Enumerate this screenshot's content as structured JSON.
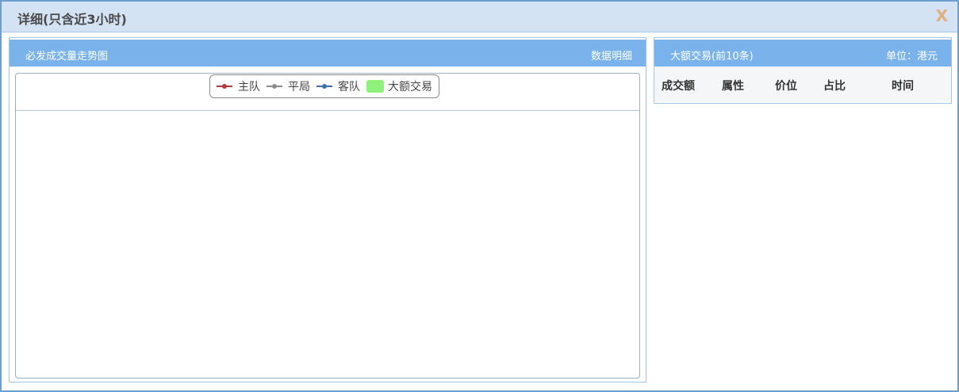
{
  "dialog": {
    "title": "详细(只含近3小时)",
    "close_label": "X"
  },
  "trend_panel": {
    "title": "必发成交量走势图",
    "detail_link": "数据明细",
    "legend": [
      {
        "label": "主队",
        "kind": "line",
        "color": "#b33a3a"
      },
      {
        "label": "平局",
        "kind": "line",
        "color": "#8c8c8c"
      },
      {
        "label": "客队",
        "kind": "line",
        "color": "#3f6fa8"
      },
      {
        "label": "大额交易",
        "kind": "swatch",
        "color": "#90f07c"
      }
    ]
  },
  "large_trades_panel": {
    "title": "大额交易(前10条)",
    "unit": "单位：港元",
    "columns": [
      "成交额",
      "属性",
      "价位",
      "占比",
      "时间"
    ]
  }
}
